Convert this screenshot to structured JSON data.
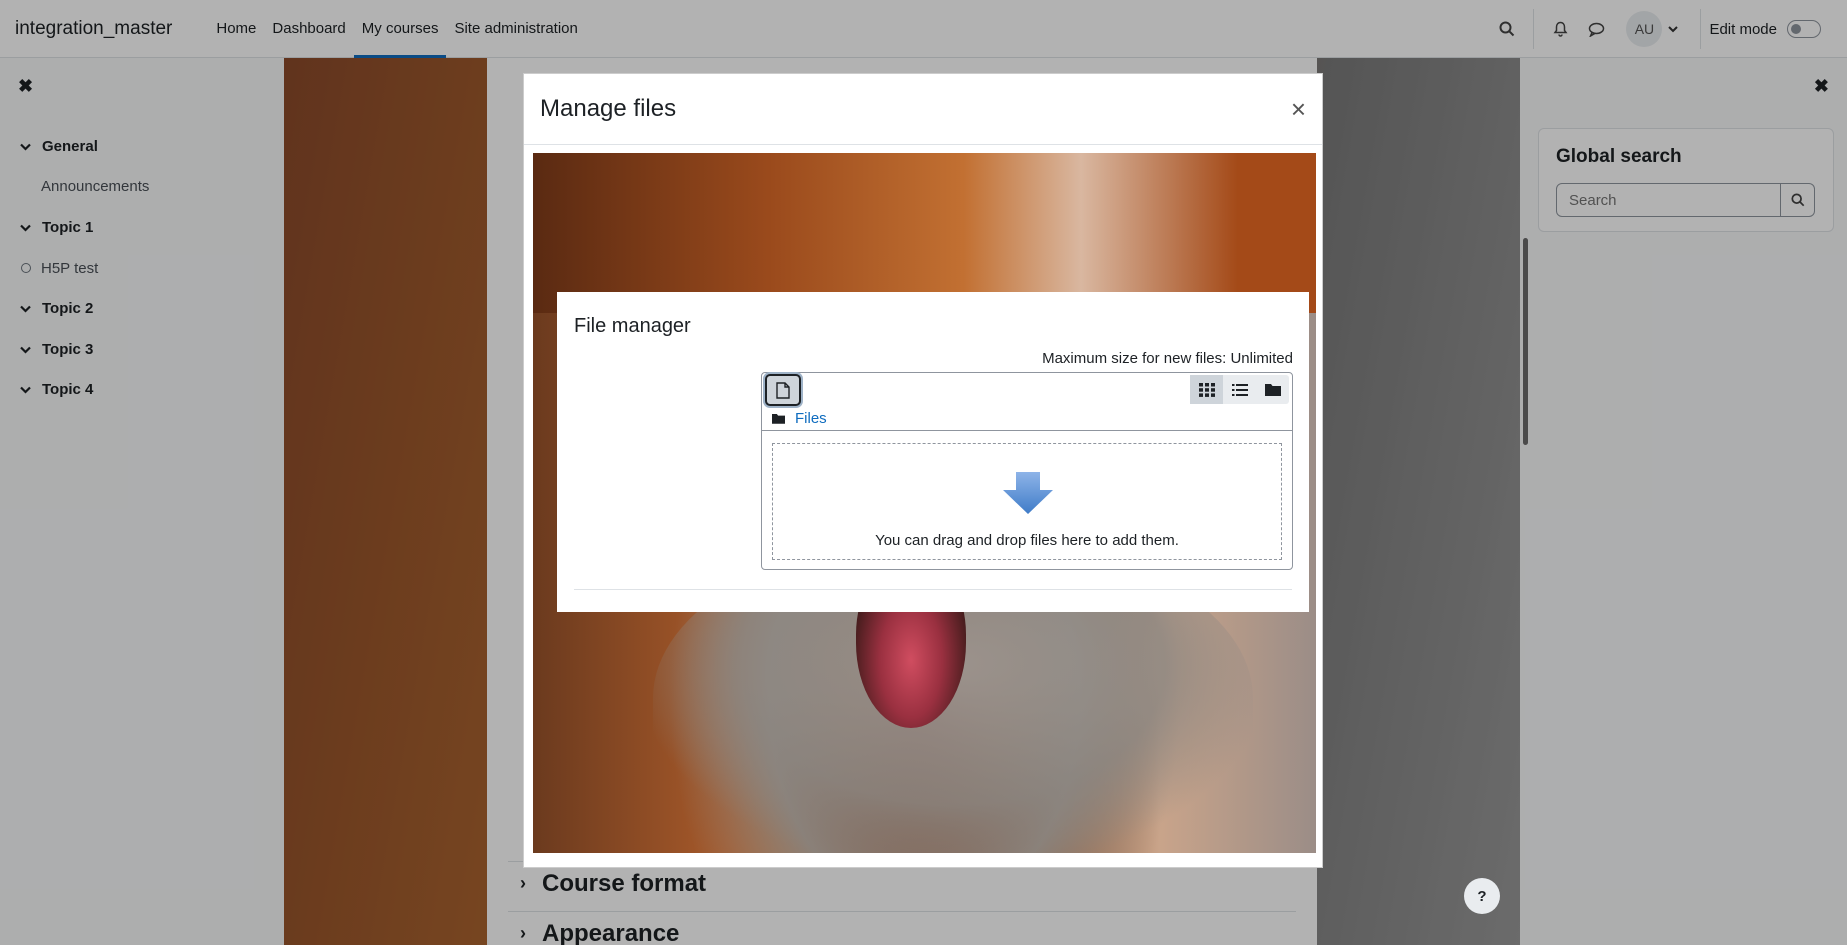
{
  "navbar": {
    "brand": "integration_master",
    "links": [
      "Home",
      "Dashboard",
      "My courses",
      "Site administration"
    ],
    "active_link": "My courses",
    "avatar_initials": "AU",
    "edit_mode_label": "Edit mode",
    "edit_mode_on": false
  },
  "course_index": {
    "items": [
      {
        "type": "section",
        "label": "General"
      },
      {
        "type": "activity",
        "label": "Announcements"
      },
      {
        "type": "section",
        "label": "Topic 1"
      },
      {
        "type": "activity-circle",
        "label": "H5P test"
      },
      {
        "type": "section",
        "label": "Topic 2"
      },
      {
        "type": "section",
        "label": "Topic 3"
      },
      {
        "type": "section",
        "label": "Topic 4"
      }
    ]
  },
  "main": {
    "sections": [
      "Course format",
      "Appearance"
    ]
  },
  "right_drawer": {
    "block_title": "Global search",
    "search_placeholder": "Search"
  },
  "help_button_label": "?",
  "modal": {
    "title": "Manage files",
    "file_manager": {
      "title": "File manager",
      "max_size": "Maximum size for new files: Unlimited",
      "path": "Files",
      "drop_text": "You can drag and drop files here to add them.",
      "views": [
        "icons-view",
        "list-view",
        "tree-view"
      ],
      "active_view": "icons-view"
    }
  },
  "colors": {
    "accent": "#0f6cbf",
    "text": "#1d2125"
  }
}
